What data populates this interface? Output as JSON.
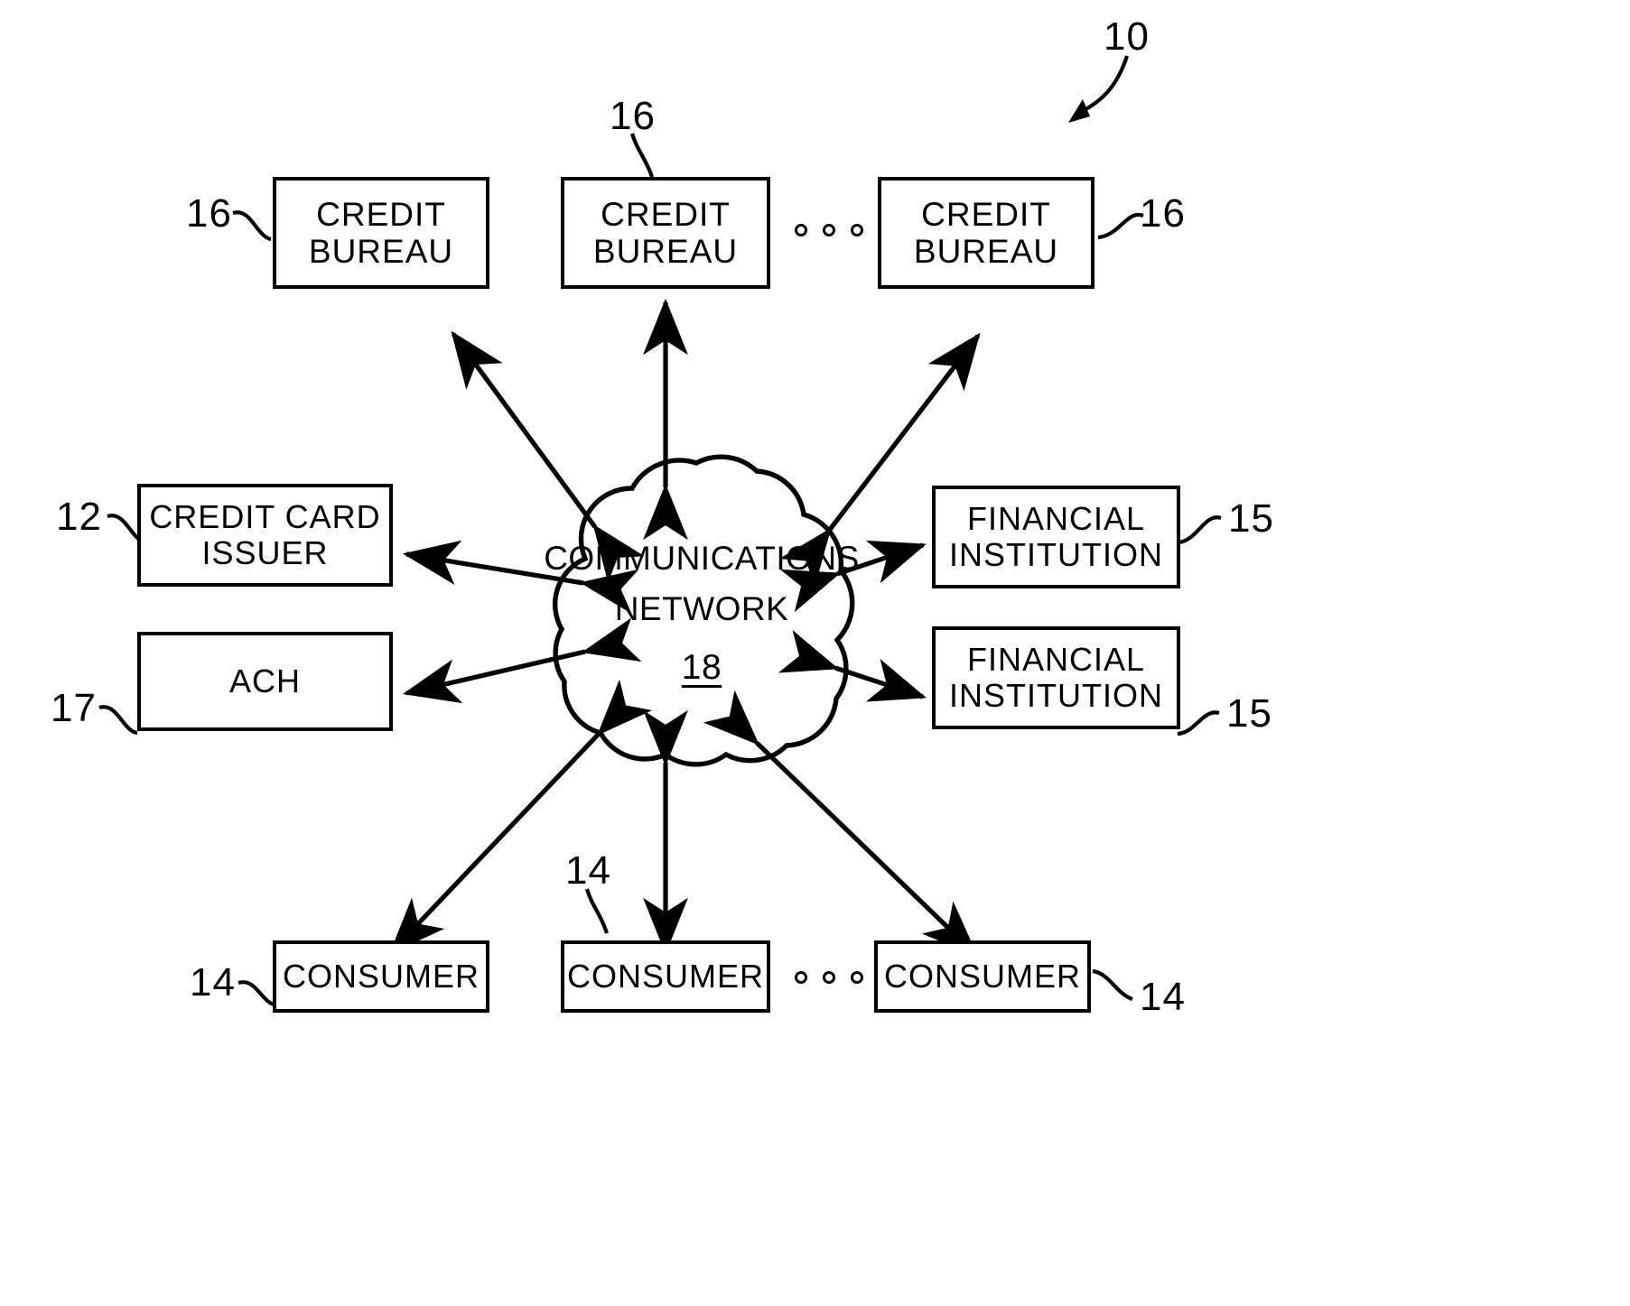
{
  "figure": {
    "reference_numeral": "10",
    "nodes": {
      "credit_bureau_1": {
        "line1": "CREDIT",
        "line2": "BUREAU",
        "ref": "16"
      },
      "credit_bureau_2": {
        "line1": "CREDIT",
        "line2": "BUREAU",
        "ref": "16"
      },
      "credit_bureau_3": {
        "line1": "CREDIT",
        "line2": "BUREAU",
        "ref": "16"
      },
      "credit_card_issuer": {
        "line1": "CREDIT  CARD",
        "line2": "ISSUER",
        "ref": "12"
      },
      "ach": {
        "line1": "ACH",
        "line2": "",
        "ref": "17"
      },
      "financial_institution_1": {
        "line1": "FINANCIAL",
        "line2": "INSTITUTION",
        "ref": "15"
      },
      "financial_institution_2": {
        "line1": "FINANCIAL",
        "line2": "INSTITUTION",
        "ref": "15"
      },
      "consumer_1": {
        "line1": "CONSUMER",
        "line2": "",
        "ref": "14"
      },
      "consumer_2": {
        "line1": "CONSUMER",
        "line2": "",
        "ref": "14"
      },
      "consumer_3": {
        "line1": "CONSUMER",
        "line2": "",
        "ref": "14"
      },
      "communications_network": {
        "line1": "COMMUNICATIONS",
        "line2": "NETWORK",
        "ref": "18"
      }
    },
    "colors": {
      "ink": "#000000",
      "paper": "#ffffff"
    }
  }
}
